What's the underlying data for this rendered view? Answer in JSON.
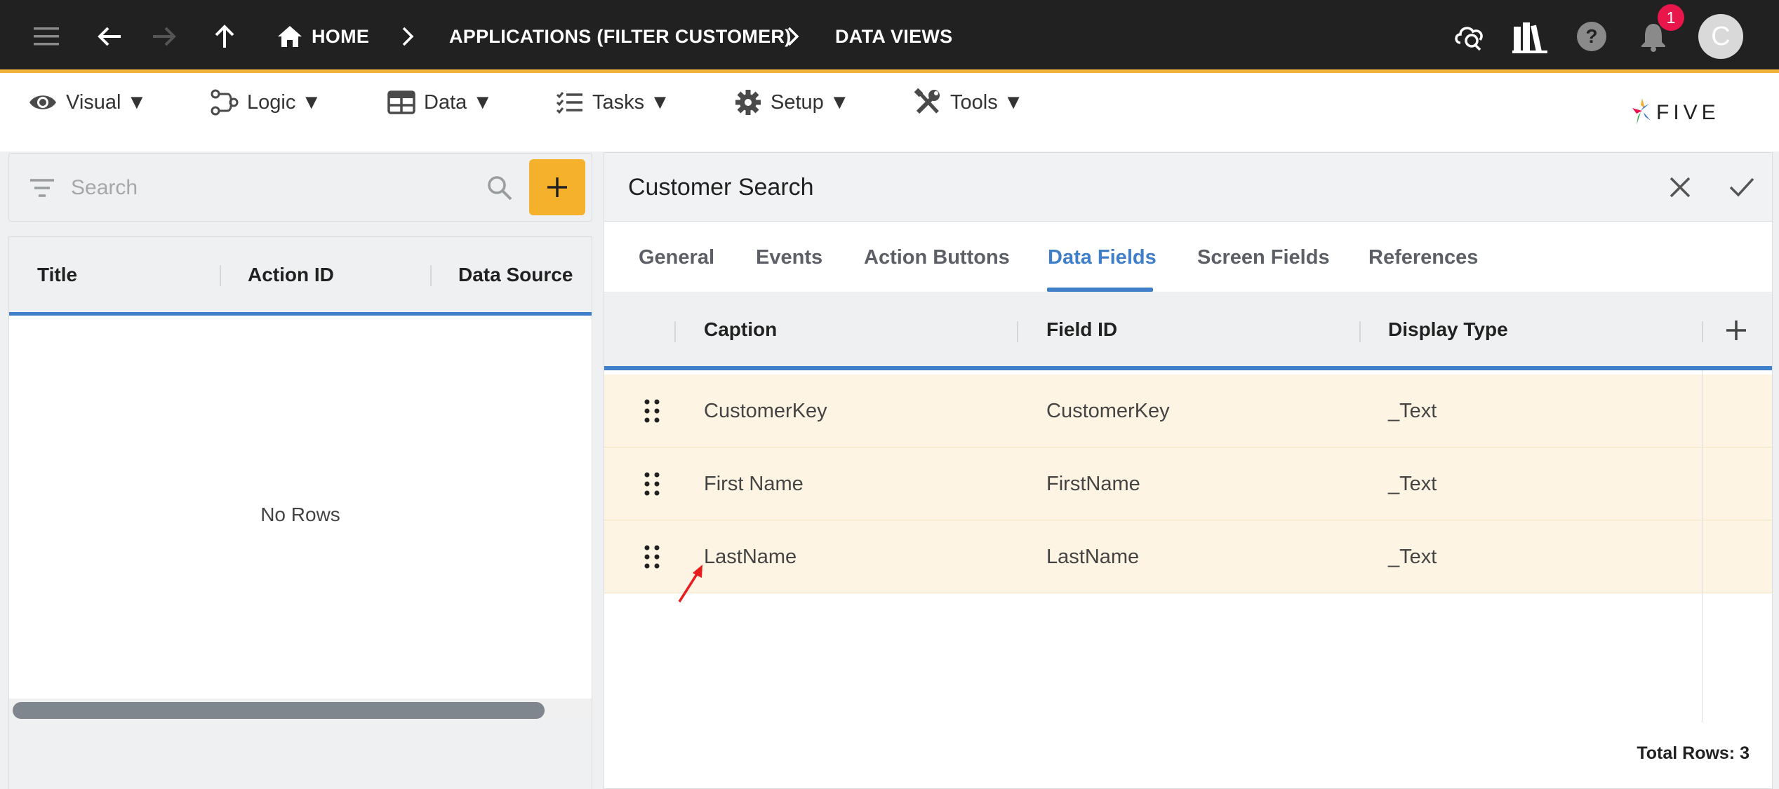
{
  "breadcrumb": {
    "home": "HOME",
    "app": "APPLICATIONS (FILTER CUSTOMER)",
    "page": "DATA VIEWS"
  },
  "notifications": {
    "count": "1"
  },
  "user": {
    "initial": "C"
  },
  "menu": {
    "items": [
      {
        "label": "Visual ▼",
        "icon": "eye-icon"
      },
      {
        "label": "Logic ▼",
        "icon": "logic-icon"
      },
      {
        "label": "Data ▼",
        "icon": "table-icon"
      },
      {
        "label": "Tasks ▼",
        "icon": "checklist-icon"
      },
      {
        "label": "Setup ▼",
        "icon": "gear-icon"
      },
      {
        "label": "Tools ▼",
        "icon": "tools-icon"
      }
    ]
  },
  "brand": {
    "logo_text": "FIVE"
  },
  "left": {
    "search_placeholder": "Search",
    "columns": [
      "Title",
      "Action ID",
      "Data Source"
    ],
    "empty_text": "No Rows"
  },
  "form": {
    "title": "Customer Search",
    "tabs": [
      "General",
      "Events",
      "Action Buttons",
      "Data Fields",
      "Screen Fields",
      "References"
    ],
    "active_tab": "Data Fields",
    "columns": [
      "Caption",
      "Field ID",
      "Display Type"
    ],
    "rows": [
      {
        "caption": "CustomerKey",
        "field_id": "CustomerKey",
        "display_type": "_Text"
      },
      {
        "caption": "First Name",
        "field_id": "FirstName",
        "display_type": "_Text"
      },
      {
        "caption": "LastName",
        "field_id": "LastName",
        "display_type": "_Text"
      }
    ],
    "total_rows": "Total Rows: 3"
  },
  "colors": {
    "accent": "#3f7fc9",
    "topbar": "#212121",
    "topbar_border": "#f0b43a",
    "add_button": "#f5b12c",
    "row_highlight": "#fef4e3",
    "badge": "#e8164b"
  }
}
